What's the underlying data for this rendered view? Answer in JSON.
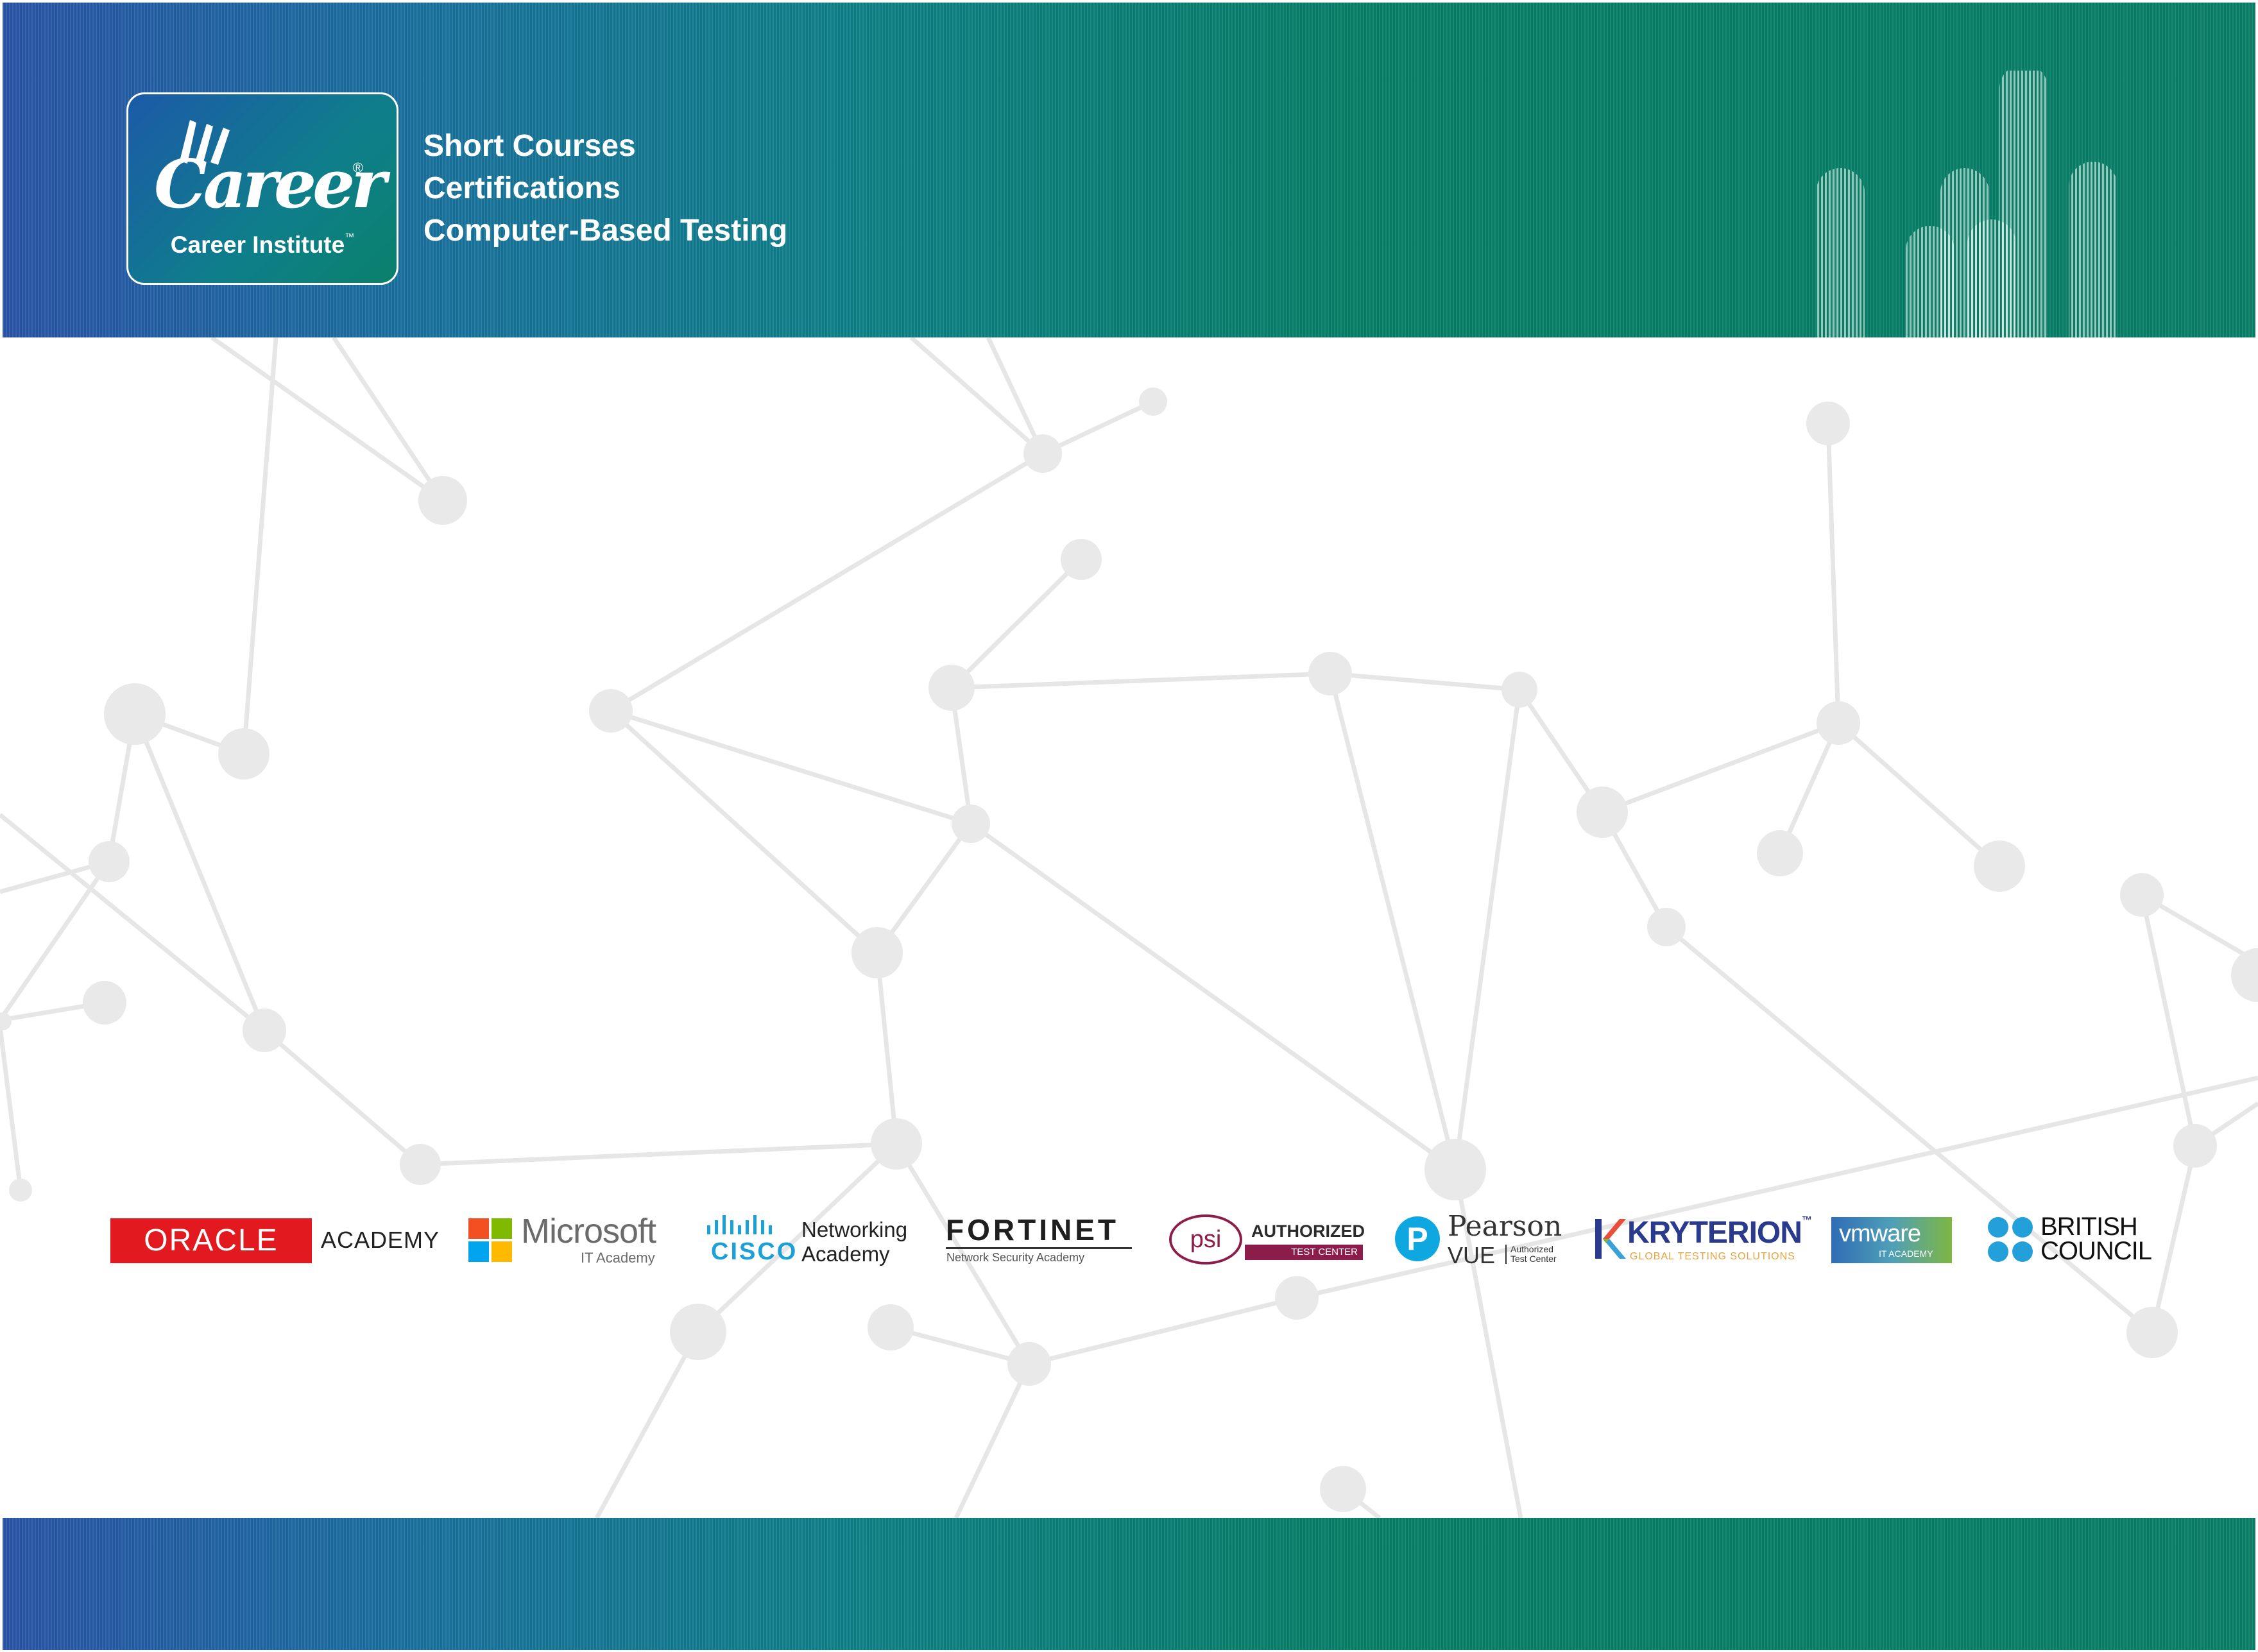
{
  "header": {
    "logo_word": "Career",
    "logo_registered": "®",
    "logo_subtitle": "Career Institute",
    "logo_tm": "™",
    "tagline": [
      "Short Courses",
      "Certifications",
      "Computer-Based Testing"
    ]
  },
  "partners": {
    "oracle": {
      "brand": "ORACLE",
      "sub": "ACADEMY"
    },
    "microsoft": {
      "brand": "Microsoft",
      "sub": "IT Academy"
    },
    "cisco": {
      "brand": "CISCO",
      "sub_line1": "Networking",
      "sub_line2": "Academy"
    },
    "fortinet": {
      "brand": "FORTINET",
      "sub": "Network Security Academy"
    },
    "psi": {
      "brand": "psi",
      "line1": "AUTHORIZED",
      "line2": "TEST CENTER"
    },
    "pearson": {
      "brand_initial": "P",
      "brand": "Pearson",
      "sub": "VUE",
      "note_line1": "Authorized",
      "note_line2": "Test Center"
    },
    "kryterion": {
      "brand": "KRYTERION",
      "tm": "™",
      "sub": "GLOBAL TESTING SOLUTIONS"
    },
    "vmware": {
      "brand": "vmware",
      "sub": "IT ACADEMY"
    },
    "british_council": {
      "line1": "BRITISH",
      "line2": "COUNCIL"
    }
  },
  "colors": {
    "band_start": "#2a55a8",
    "band_end": "#0a806a",
    "oracle_red": "#e2191f",
    "cisco_blue": "#1ba0d7",
    "psi_maroon": "#8c1d4a",
    "pearson_blue": "#0ea7df",
    "kryterion_navy": "#2a3a8c",
    "network_gray": "#e9e9e9"
  }
}
